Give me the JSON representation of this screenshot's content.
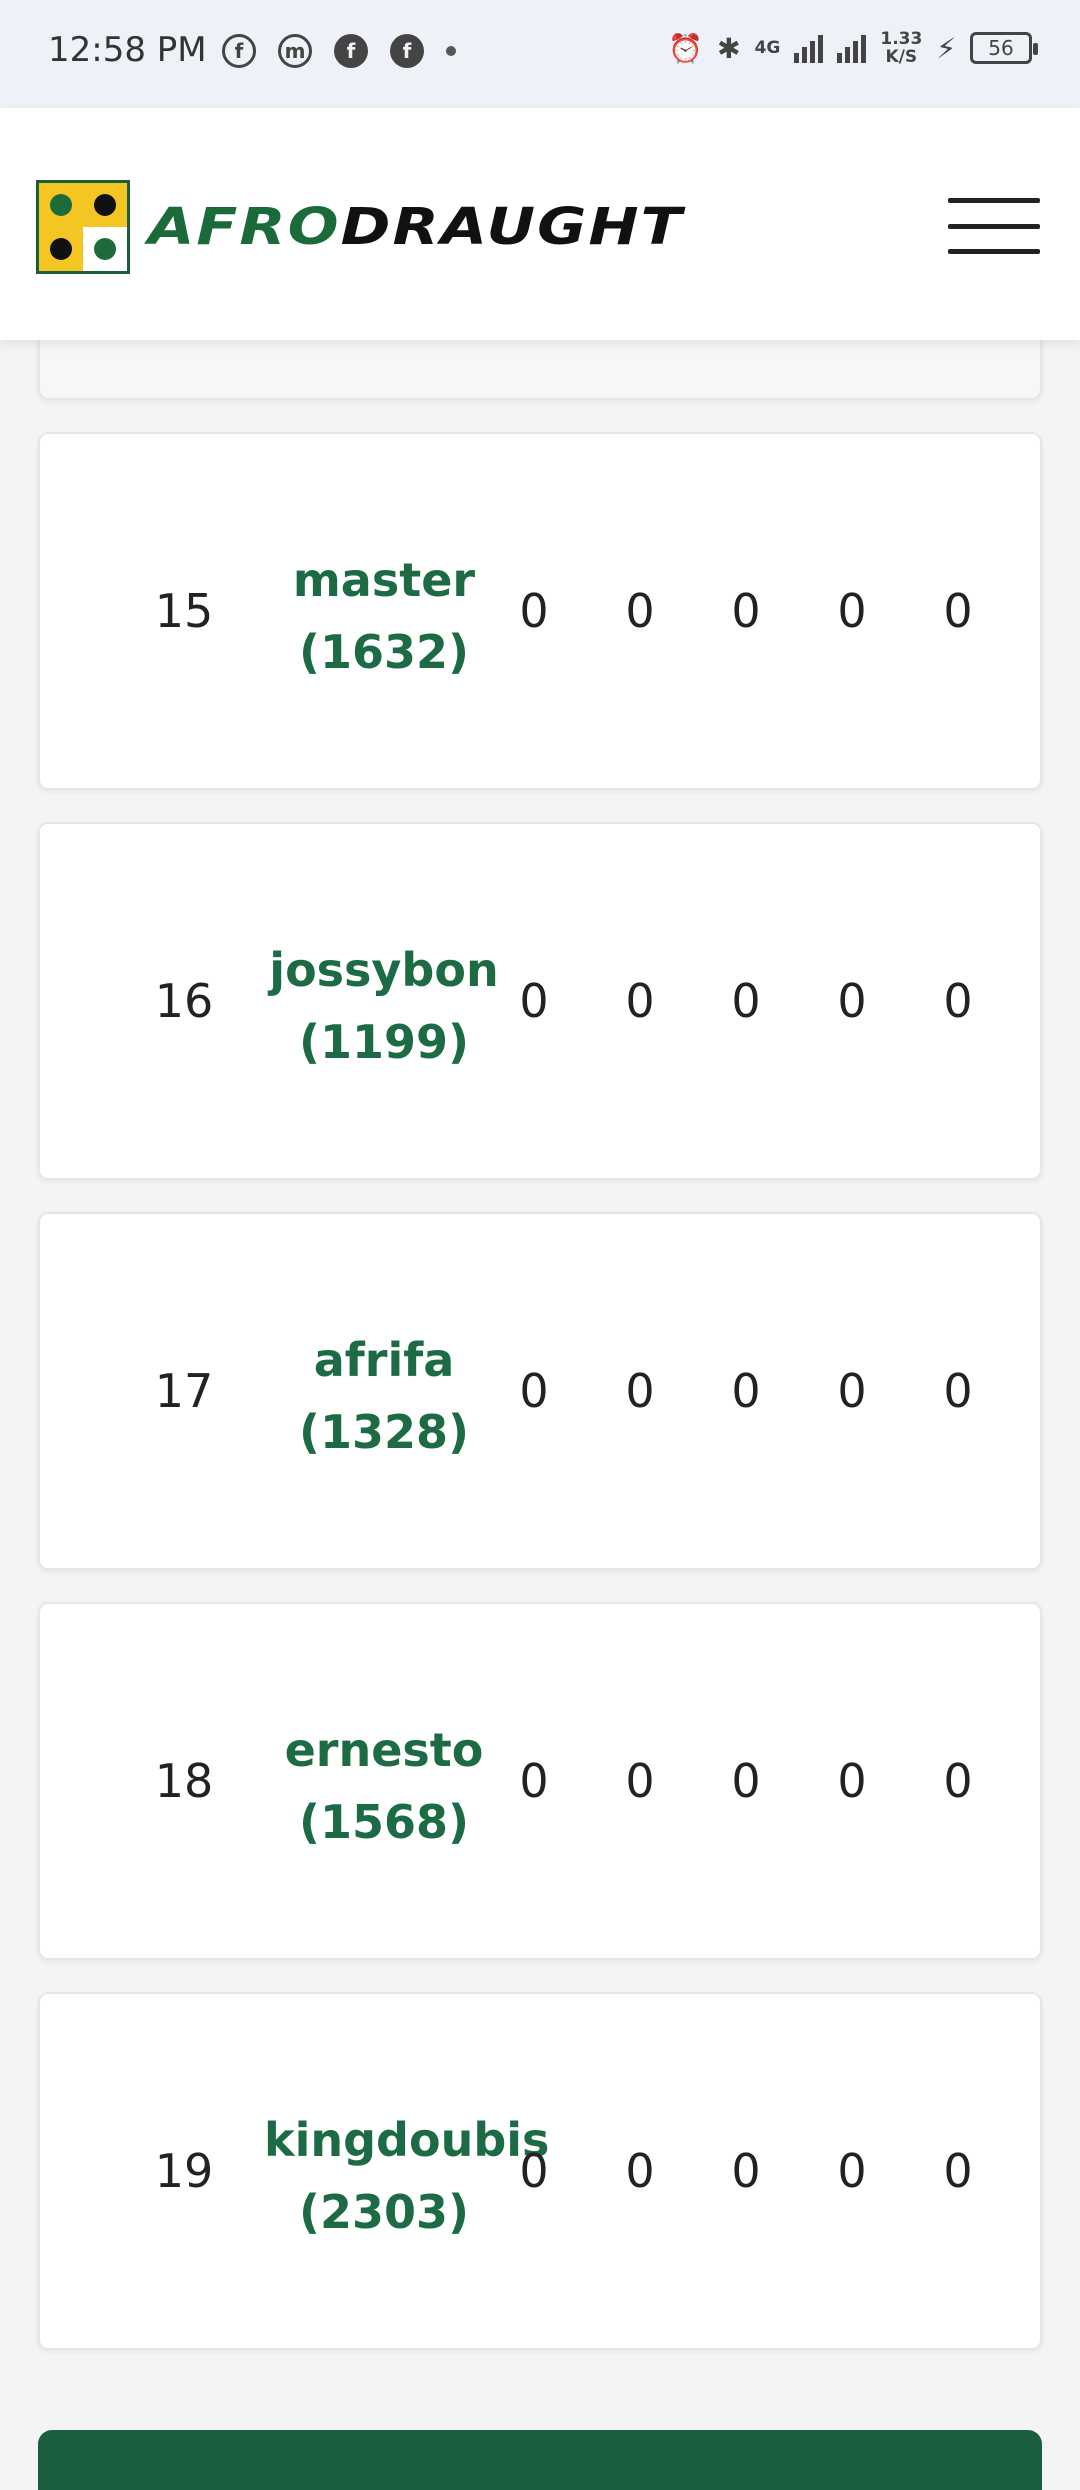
{
  "status_bar": {
    "time": "12:58 PM",
    "net_speed_value": "1.33",
    "net_speed_unit": "K/S",
    "network_type": "4G",
    "battery": "56",
    "icons_left": [
      "facebook-icon",
      "messenger-icon",
      "facebook-icon",
      "facebook-icon"
    ]
  },
  "header": {
    "logo_text_a": "AFRO",
    "logo_text_b": "DRAUGHT"
  },
  "leaderboard": {
    "rows": [
      {
        "rank": "15",
        "name": "master",
        "rating": "(1632)",
        "stats": [
          "0",
          "0",
          "0",
          "0",
          "0"
        ]
      },
      {
        "rank": "16",
        "name": "jossybon",
        "rating": "(1199)",
        "stats": [
          "0",
          "0",
          "0",
          "0",
          "0"
        ]
      },
      {
        "rank": "17",
        "name": "afrifa",
        "rating": "(1328)",
        "stats": [
          "0",
          "0",
          "0",
          "0",
          "0"
        ]
      },
      {
        "rank": "18",
        "name": "ernesto",
        "rating": "(1568)",
        "stats": [
          "0",
          "0",
          "0",
          "0",
          "0"
        ]
      },
      {
        "rank": "19",
        "name": "kingdoubis",
        "rating": "(2303)",
        "stats": [
          "0",
          "0",
          "0",
          "0",
          "0"
        ]
      }
    ]
  },
  "colors": {
    "brand_green": "#1b6b3a",
    "brand_yellow": "#f3c623",
    "player_link": "#1c6b45"
  }
}
